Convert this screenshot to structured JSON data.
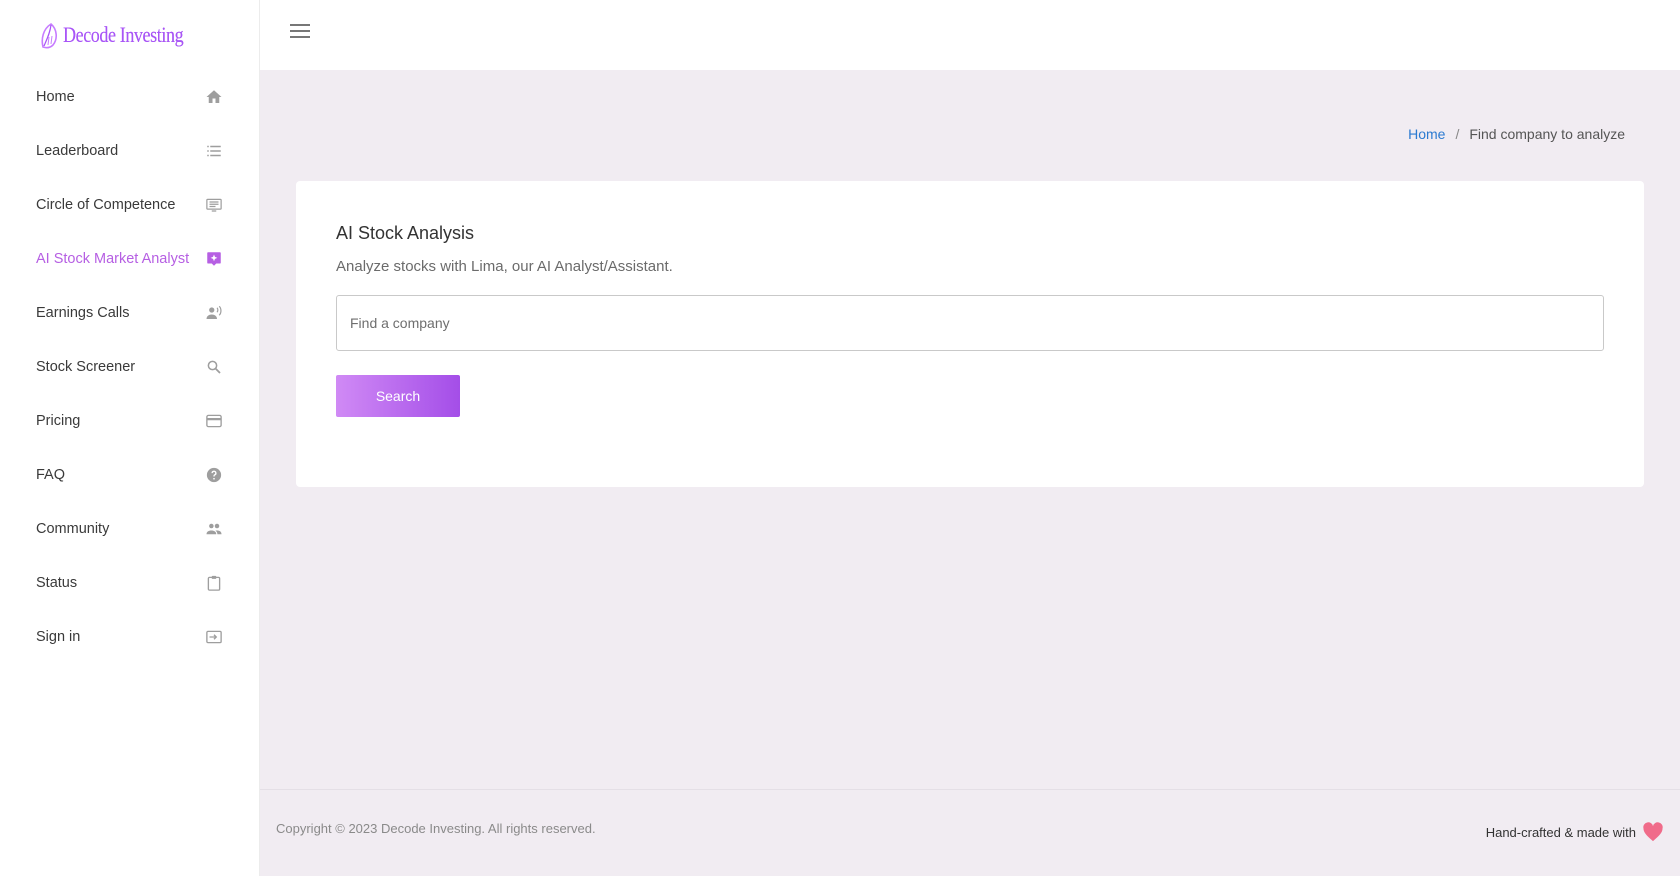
{
  "brand": {
    "name": "Decode Investing"
  },
  "sidebar": {
    "items": [
      {
        "label": "Home",
        "icon": "home-icon"
      },
      {
        "label": "Leaderboard",
        "icon": "list-icon"
      },
      {
        "label": "Circle of Competence",
        "icon": "monitor-list-icon"
      },
      {
        "label": "AI Stock Market Analyst",
        "icon": "sparkle-chat-icon",
        "active": true
      },
      {
        "label": "Earnings Calls",
        "icon": "person-voice-icon"
      },
      {
        "label": "Stock Screener",
        "icon": "search-icon"
      },
      {
        "label": "Pricing",
        "icon": "credit-card-icon"
      },
      {
        "label": "FAQ",
        "icon": "help-icon"
      },
      {
        "label": "Community",
        "icon": "people-icon"
      },
      {
        "label": "Status",
        "icon": "clipboard-icon"
      },
      {
        "label": "Sign in",
        "icon": "sign-in-icon"
      }
    ]
  },
  "breadcrumb": {
    "home": "Home",
    "separator": "/",
    "current": "Find company to analyze"
  },
  "card": {
    "title": "AI Stock Analysis",
    "subtitle": "Analyze stocks with Lima, our AI Analyst/Assistant.",
    "search_placeholder": "Find a company",
    "search_value": "",
    "search_button": "Search"
  },
  "footer": {
    "copyright": "Copyright © 2023 Decode Investing. All rights reserved.",
    "madewith": "Hand-crafted & made with"
  },
  "colors": {
    "accent": "#b65fe3",
    "link": "#2b7ad1",
    "heart": "#f06b8a",
    "icon": "#9e9e9e"
  }
}
